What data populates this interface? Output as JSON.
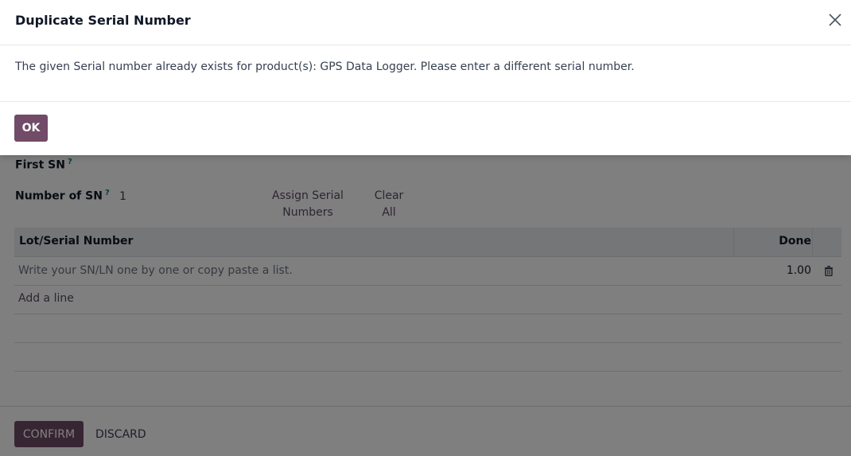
{
  "dialog": {
    "title": "Duplicate Serial Number",
    "message": "The given Serial number already exists for product(s): GPS Data Logger. Please enter a different serial number.",
    "ok_label": "OK",
    "close_icon": "close-icon"
  },
  "wizard": {
    "first_sn_label": "First SN",
    "first_sn_help": "?",
    "number_sn_label": "Number of SN",
    "number_sn_help": "?",
    "number_sn_value": "1",
    "assign_label": "Assign Serial Numbers",
    "clear_label": "Clear All",
    "table": {
      "columns": [
        "Lot/Serial Number",
        "Done"
      ],
      "rows": [
        {
          "placeholder": "Write your SN/LN one by one or copy paste a list.",
          "done": "1.00",
          "action_icon": "trash-icon"
        }
      ],
      "add_line": "Add a line"
    },
    "confirm_label": "CONFIRM",
    "discard_label": "DISCARD"
  },
  "colors": {
    "primary": "#714b67",
    "link": "#5b4a63",
    "overlay": "rgba(0,0,0,0.5)"
  }
}
